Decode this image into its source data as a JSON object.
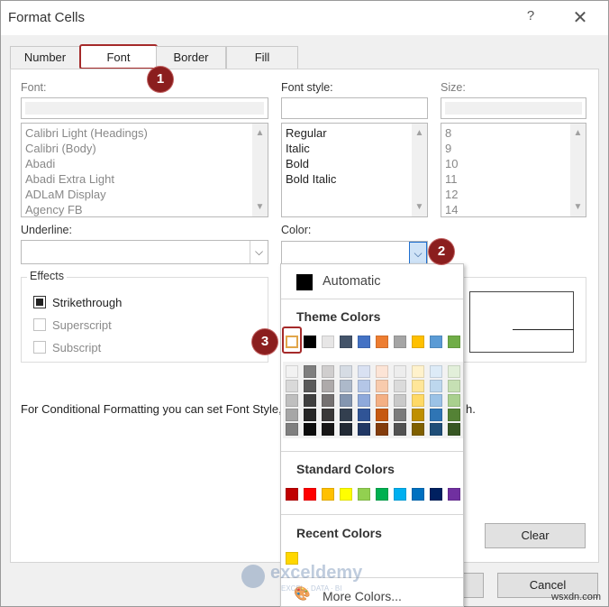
{
  "window": {
    "title": "Format Cells",
    "help_label": "?",
    "close_label": "✕"
  },
  "tabs": [
    {
      "label": "Number"
    },
    {
      "label": "Font"
    },
    {
      "label": "Border"
    },
    {
      "label": "Fill"
    }
  ],
  "font": {
    "label": "Font:",
    "items": [
      "Calibri Light (Headings)",
      "Calibri (Body)",
      "Abadi",
      "Abadi Extra Light",
      "ADLaM Display",
      "Agency FB"
    ]
  },
  "font_style": {
    "label": "Font style:",
    "items": [
      "Regular",
      "Italic",
      "Bold",
      "Bold Italic"
    ]
  },
  "size": {
    "label": "Size:",
    "items": [
      "8",
      "9",
      "10",
      "11",
      "12",
      "14"
    ]
  },
  "underline": {
    "label": "Underline:"
  },
  "color": {
    "label": "Color:"
  },
  "effects": {
    "title": "Effects",
    "strikethrough": "Strikethrough",
    "superscript": "Superscript",
    "subscript": "Subscript"
  },
  "info_text": "For Conditional Formatting you can set Font Style,",
  "info_text_tail": "h.",
  "buttons": {
    "clear": "Clear",
    "cancel": "Cancel"
  },
  "picker": {
    "automatic": "Automatic",
    "theme_title": "Theme Colors",
    "standard_title": "Standard Colors",
    "recent_title": "Recent Colors",
    "more_colors": "More Colors...",
    "theme_top": [
      "#ffffff",
      "#000000",
      "#e7e6e6",
      "#44546a",
      "#4472c4",
      "#ed7d31",
      "#a5a5a5",
      "#ffc000",
      "#5b9bd5",
      "#70ad47"
    ],
    "theme_shades": [
      [
        "#f2f2f2",
        "#d9d9d9",
        "#bfbfbf",
        "#a6a6a6",
        "#808080"
      ],
      [
        "#7f7f7f",
        "#595959",
        "#404040",
        "#262626",
        "#0d0d0d"
      ],
      [
        "#d0cece",
        "#aeaaaa",
        "#757171",
        "#3a3838",
        "#171616"
      ],
      [
        "#d6dce4",
        "#adb9ca",
        "#8496b0",
        "#333f4f",
        "#222a35"
      ],
      [
        "#d9e1f2",
        "#b4c6e7",
        "#8ea9db",
        "#305496",
        "#203764"
      ],
      [
        "#fce4d6",
        "#f8cbad",
        "#f4b084",
        "#c65911",
        "#833c0c"
      ],
      [
        "#ededed",
        "#dbdbdb",
        "#c9c9c9",
        "#7b7b7b",
        "#525252"
      ],
      [
        "#fff2cc",
        "#ffe699",
        "#ffd966",
        "#bf8f00",
        "#806000"
      ],
      [
        "#ddebf7",
        "#bdd7ee",
        "#9bc2e6",
        "#2f75b5",
        "#1f4e78"
      ],
      [
        "#e2efda",
        "#c6e0b4",
        "#a9d08e",
        "#548235",
        "#375623"
      ]
    ],
    "standard": [
      "#c00000",
      "#ff0000",
      "#ffc000",
      "#ffff00",
      "#92d050",
      "#00b050",
      "#00b0f0",
      "#0070c0",
      "#002060",
      "#7030a0"
    ],
    "recent": [
      "#ffd700"
    ]
  },
  "badges": [
    "1",
    "2",
    "3"
  ],
  "watermark": {
    "name": "exceldemy",
    "tagline": "EXCEL · DATA · BI"
  },
  "corner_mark": "wsxdn.com"
}
